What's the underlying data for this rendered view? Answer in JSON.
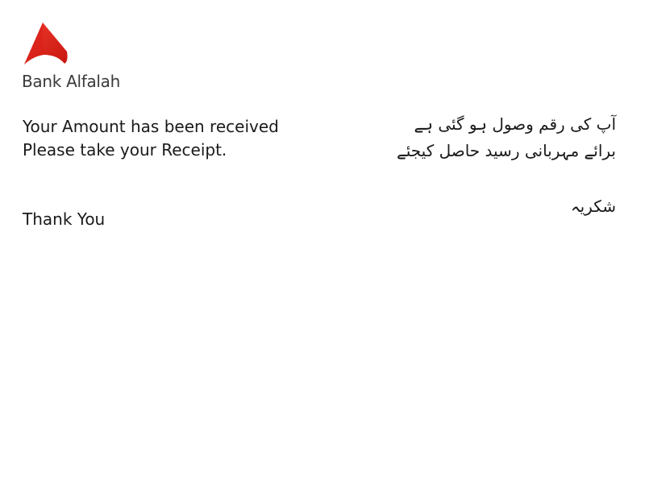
{
  "brand": {
    "name": "Bank Alfalah",
    "logo_icon": "bank-alfalah-logo-icon",
    "accent_color": "#e2231a",
    "accent_dark": "#b3130f"
  },
  "message_en": {
    "line1": "Your Amount has been received",
    "line2": "Please take your Receipt.",
    "thanks": "Thank You"
  },
  "message_ur": {
    "line1": "آپ کی رقم وصول ہو گئی ہے",
    "line2": "برائے مہربانی رسید حاصل کیجئے",
    "thanks": "شکریہ"
  }
}
